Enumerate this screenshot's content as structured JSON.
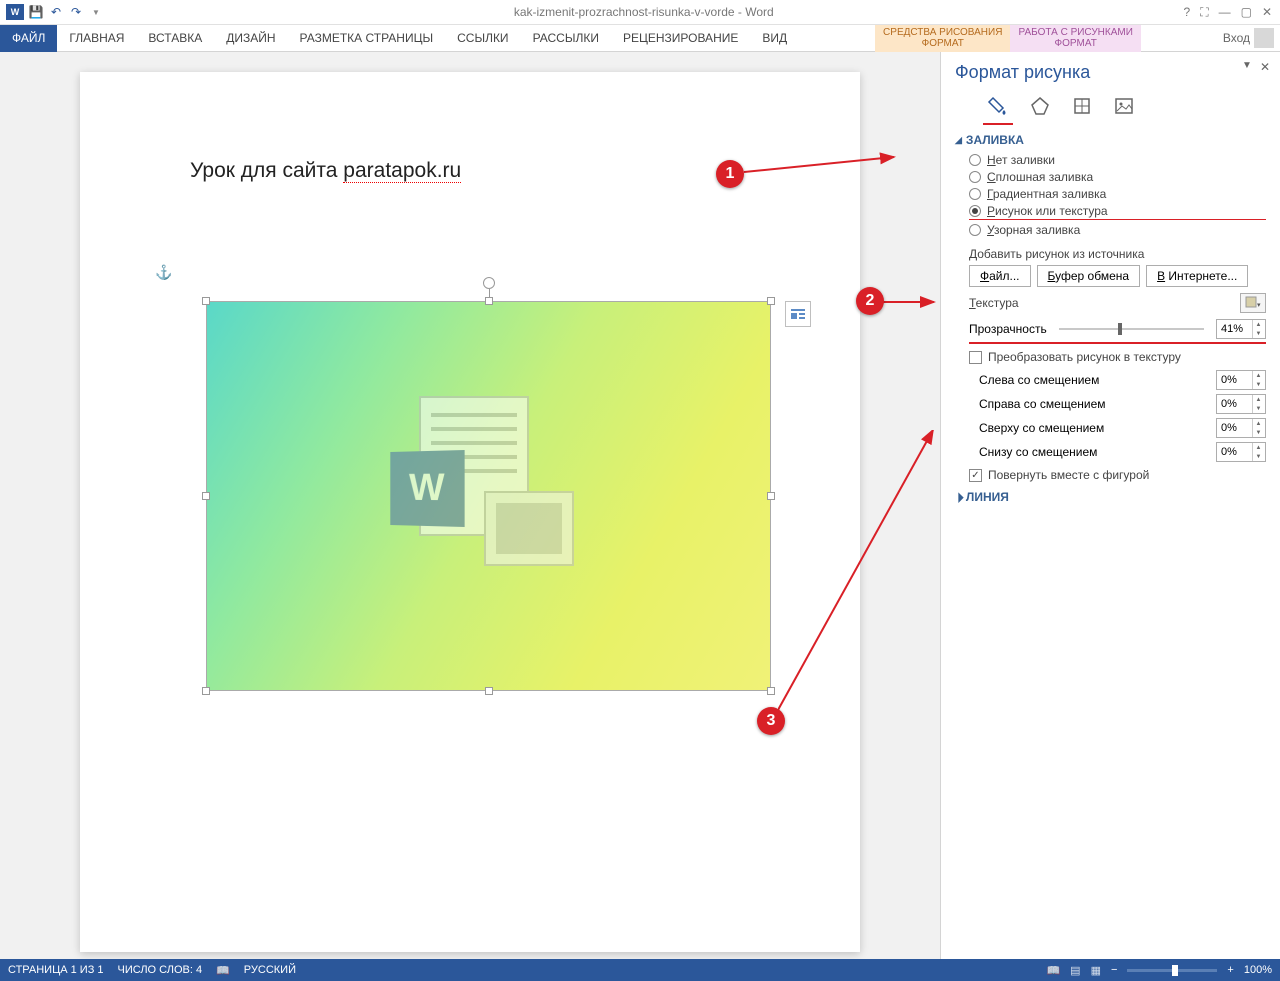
{
  "titlebar": {
    "doc_title": "kak-izmenit-prozrachnost-risunka-v-vorde - Word"
  },
  "ribbon": {
    "file": "ФАЙЛ",
    "tabs": [
      "ГЛАВНАЯ",
      "ВСТАВКА",
      "ДИЗАЙН",
      "РАЗМЕТКА СТРАНИЦЫ",
      "ССЫЛКИ",
      "РАССЫЛКИ",
      "РЕЦЕНЗИРОВАНИЕ",
      "ВИД"
    ],
    "ctx1_top": "СРЕДСТВА РИСОВАНИЯ",
    "ctx1_bottom": "ФОРМАТ",
    "ctx2_top": "РАБОТА С РИСУНКАМИ",
    "ctx2_bottom": "ФОРМАТ",
    "login": "Вход"
  },
  "document": {
    "heading_pre": "Урок для сайта ",
    "heading_site": "paratapok.ru"
  },
  "annotations": {
    "a1": "1",
    "a2": "2",
    "a3": "3"
  },
  "pane": {
    "title": "Формат рисунка",
    "sec_fill": "ЗАЛИВКА",
    "r_none": "Нет заливки",
    "r_solid": "Сплошная заливка",
    "r_grad": "Градиентная заливка",
    "r_pic": "Рисунок или текстура",
    "r_pattern": "Узорная заливка",
    "add_from": "Добавить рисунок из источника",
    "btn_file": "Файл...",
    "btn_clip": "Буфер обмена",
    "btn_web": "В Интернете...",
    "texture": "Текстура",
    "transparency": "Прозрачность",
    "transparency_val": "41%",
    "tile": "Преобразовать рисунок в текстуру",
    "off_left": "Слева со смещением",
    "off_right": "Справа со смещением",
    "off_top": "Сверху со смещением",
    "off_bottom": "Снизу со смещением",
    "off_val": "0%",
    "rotate": "Повернуть вместе с фигурой",
    "sec_line": "ЛИНИЯ"
  },
  "statusbar": {
    "page": "СТРАНИЦА 1 ИЗ 1",
    "words": "ЧИСЛО СЛОВ: 4",
    "lang": "РУССКИЙ",
    "zoom": "100%"
  }
}
